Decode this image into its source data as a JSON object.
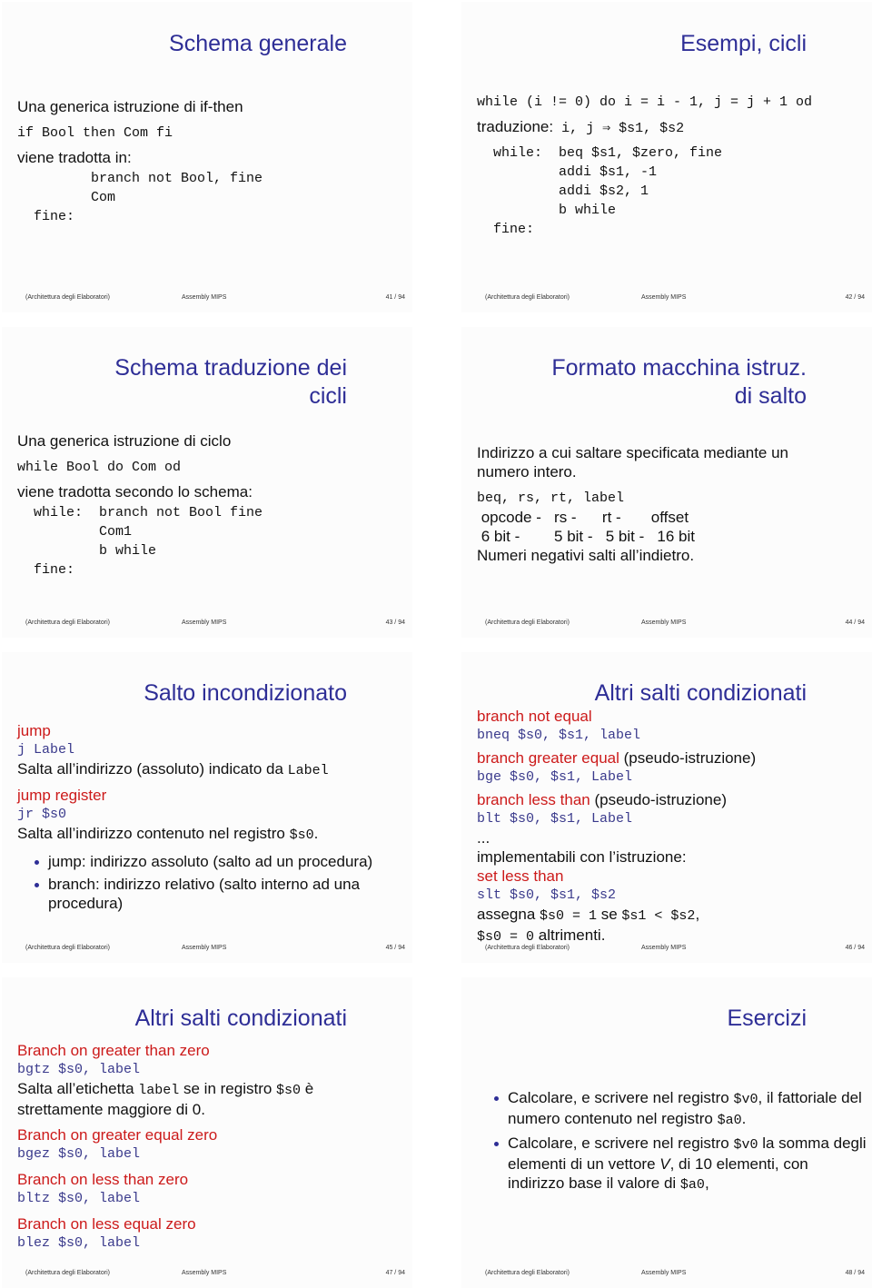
{
  "footer": {
    "course": "(Architettura degli Elaboratori)",
    "topic": "Assembly MIPS"
  },
  "slides": [
    {
      "page": "41 / 94",
      "title": "Schema generale",
      "lines": [
        "Una generica istruzione di if-then",
        "if Bool then Com fi",
        "viene tradotta in:",
        "         branch not Bool, fine",
        "         Com",
        "  fine:"
      ]
    },
    {
      "page": "42 / 94",
      "title": "Esempi, cicli",
      "lines": [
        "while (i != 0) do i = i - 1, j = j + 1 od",
        "traduzione:",
        " i, j ⇒ $s1, $s2",
        "  while:  beq $s1, $zero, fine",
        "          addi $s1, -1",
        "          addi $s2, 1",
        "          b while",
        "  fine:"
      ]
    },
    {
      "page": "43 / 94",
      "title_line1": "Schema traduzione dei",
      "title_line2": "cicli",
      "lines": [
        "Una generica istruzione di ciclo",
        "while Bool do Com od",
        "viene tradotta secondo lo schema:",
        "  while:  branch not Bool fine",
        "          Com1",
        "          b while",
        "  fine:"
      ]
    },
    {
      "page": "44 / 94",
      "title_line1": "Formato macchina istruz.",
      "title_line2": "di salto",
      "lines": [
        "Indirizzo a cui saltare specificata mediante un numero intero.",
        "beq, rs, rt, label",
        " opcode -   rs -      rt -       offset",
        " 6 bit -        5 bit -   5 bit -   16 bit",
        "Numeri negativi salti all’indietro."
      ]
    },
    {
      "page": "45 / 94",
      "title": "Salto incondizionato",
      "jump_label": "jump",
      "jump_code": "j Label",
      "jump_desc": "Salta all’indirizzo (assoluto) indicato da ",
      "jump_desc_code": "Label",
      "jr_label": "jump register",
      "jr_code": "jr $s0",
      "jr_desc": "Salta all’indirizzo contenuto nel registro ",
      "jr_desc_code": "$s0",
      "jr_desc_end": ".",
      "bullets": [
        "jump: indirizzo assoluto (salto ad un procedura)",
        "branch: indirizzo relativo (salto interno ad una procedura)"
      ]
    },
    {
      "page": "46 / 94",
      "title": "Altri salti condizionati",
      "bne_label": "branch not equal",
      "bne_code": "bneq $s0, $s1, label",
      "bge_label": "branch greater equal",
      "bge_note": " (pseudo-istruzione)",
      "bge_code": "bge $s0, $s1, Label",
      "blt_label": "branch less than",
      "blt_note": " (pseudo-istruzione)",
      "blt_code": "blt $s0, $s1, Label",
      "ellipsis": "...",
      "impl": "implementabili con l’istruzione:",
      "slt_label": "set less than",
      "slt_code": "slt $s0, $s1, $s2",
      "assign_1": "assegna ",
      "assign_c1": "$s0 = 1",
      "assign_2": " se ",
      "assign_c2": "$s1 < $s2",
      "assign_3": ",",
      "assign_c3": "$s0 = 0",
      "assign_4": " altrimenti."
    },
    {
      "page": "47 / 94",
      "title": "Altri salti condizionati",
      "bgtz_label": "Branch on greater than zero",
      "bgtz_code": "bgtz $s0, label",
      "bgtz_desc_1": "Salta all’etichetta ",
      "bgtz_desc_c1": "label",
      "bgtz_desc_2": " se in registro ",
      "bgtz_desc_c2": "$s0",
      "bgtz_desc_3": " è strettamente maggiore di 0.",
      "bgez_label": "Branch on greater equal zero",
      "bgez_code": "bgez $s0, label",
      "bltz_label": "Branch on less than zero",
      "bltz_code": "bltz $s0, label",
      "blez_label": "Branch on less equal zero",
      "blez_code": "blez $s0, label"
    },
    {
      "page": "48 / 94",
      "title": "Esercizi",
      "b1_1": "Calcolare, e scrivere nel registro ",
      "b1_c1": "$v0",
      "b1_2": ", il fattoriale del numero contenuto nel registro ",
      "b1_c2": "$a0",
      "b1_3": ".",
      "b2_1": "Calcolare, e scrivere nel registro ",
      "b2_c1": "$v0",
      "b2_2": " la somma degli elementi di un vettore ",
      "b2_v": "V",
      "b2_3": ", di 10 elementi, con indirizzo base il valore di ",
      "b2_c2": "$a0",
      "b2_4": ","
    }
  ]
}
